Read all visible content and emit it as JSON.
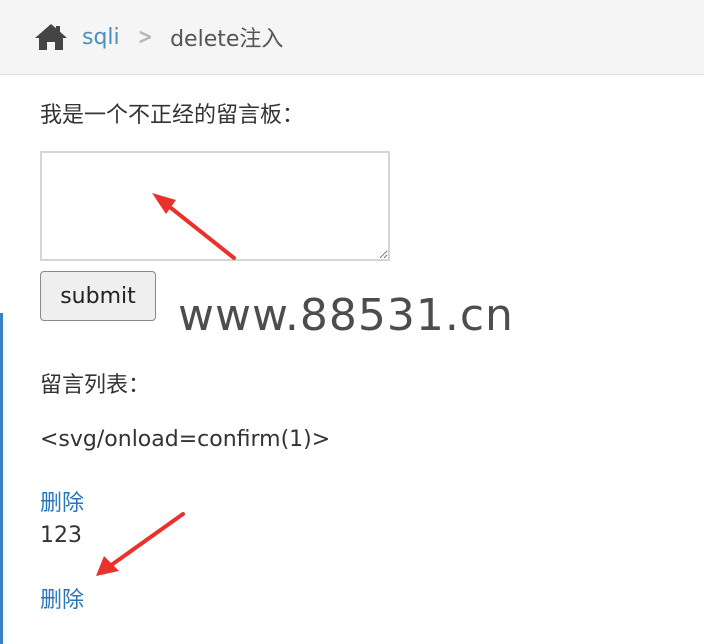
{
  "breadcrumb": {
    "home_icon": "home-icon",
    "parent": "sqli",
    "separator": ">",
    "current": "delete注入"
  },
  "form": {
    "prompt": "我是一个不正经的留言板：",
    "textarea_value": "",
    "submit_label": "submit"
  },
  "watermark": "www.88531.cn",
  "messages": {
    "title": "留言列表：",
    "items": [
      {
        "content": "<svg/onload=confirm(1)>",
        "delete_label": "删除"
      },
      {
        "content": "123",
        "delete_label": "删除"
      }
    ]
  },
  "colors": {
    "link": "#4c8fbd",
    "annotation_arrow": "#e8322b"
  }
}
